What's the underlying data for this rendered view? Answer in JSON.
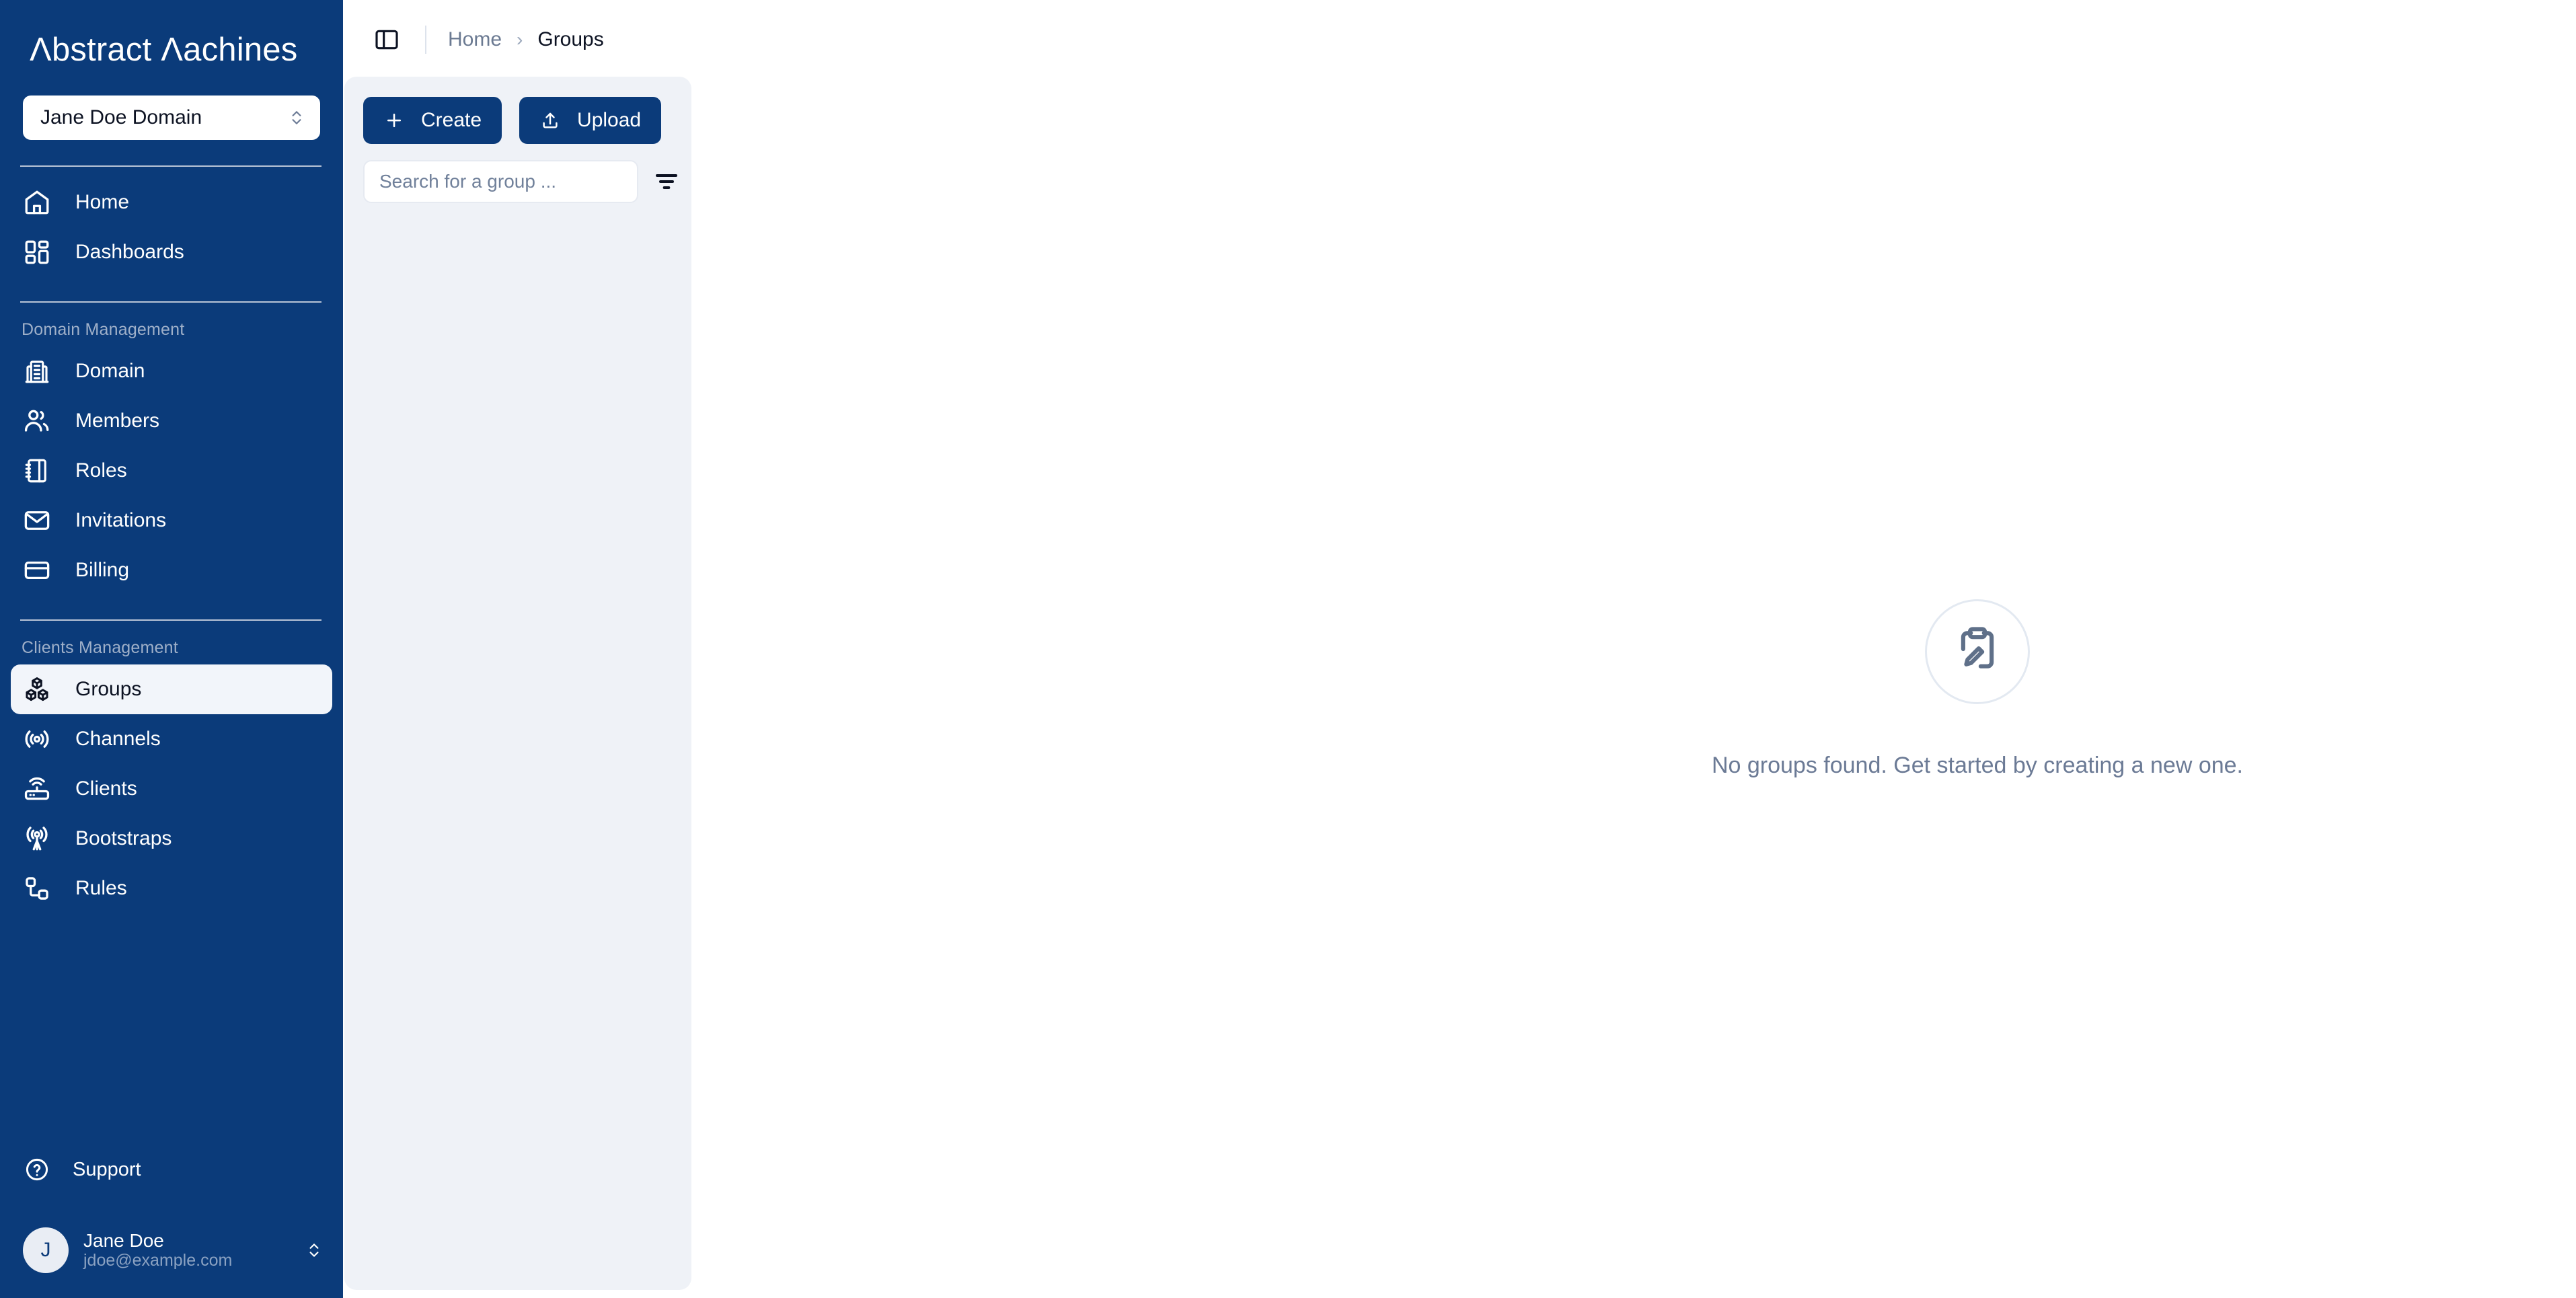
{
  "brand": {
    "name": "Abstract Machines",
    "name_prefix_a": "Λ",
    "name_rest": "bstract ",
    "name_m": "Λ",
    "name_tail": "achines"
  },
  "sidebar": {
    "domain_selector": {
      "value": "Jane Doe Domain",
      "icon": "chevron-up-down-icon"
    },
    "primary_items": [
      {
        "label": "Home",
        "icon": "home-icon",
        "active": false
      },
      {
        "label": "Dashboards",
        "icon": "dashboards-grid-icon",
        "active": false
      }
    ],
    "sections": [
      {
        "label": "Domain Management",
        "items": [
          {
            "label": "Domain",
            "icon": "building-icon",
            "active": false
          },
          {
            "label": "Members",
            "icon": "users-icon",
            "active": false
          },
          {
            "label": "Roles",
            "icon": "notebook-icon",
            "active": false
          },
          {
            "label": "Invitations",
            "icon": "envelope-icon",
            "active": false
          },
          {
            "label": "Billing",
            "icon": "credit-card-icon",
            "active": false
          }
        ]
      },
      {
        "label": "Clients Management",
        "items": [
          {
            "label": "Groups",
            "icon": "boxes-icon",
            "active": true
          },
          {
            "label": "Channels",
            "icon": "broadcast-icon",
            "active": false
          },
          {
            "label": "Clients",
            "icon": "router-icon",
            "active": false
          },
          {
            "label": "Bootstraps",
            "icon": "antenna-icon",
            "active": false
          },
          {
            "label": "Rules",
            "icon": "rules-nodes-icon",
            "active": false
          }
        ]
      }
    ],
    "support": {
      "label": "Support",
      "icon": "help-circle-icon"
    },
    "user": {
      "initial": "J",
      "name": "Jane Doe",
      "email": "jdoe@example.com",
      "icon": "chevron-up-down-icon"
    }
  },
  "topbar": {
    "sidebar_toggle_icon": "panel-toggle-icon",
    "breadcrumb": [
      {
        "label": "Home",
        "current": false
      },
      {
        "label": "Groups",
        "current": true
      }
    ],
    "breadcrumb_separator": "›"
  },
  "toolbar": {
    "create_label": "Create",
    "create_icon": "plus-icon",
    "upload_label": "Upload",
    "upload_icon": "upload-icon",
    "search_placeholder": "Search for a group ...",
    "search_value": "",
    "filter_icon": "filter-icon"
  },
  "empty_state": {
    "icon": "clipboard-pen-icon",
    "message": "No groups found. Get started by creating a new one."
  },
  "colors": {
    "sidebar_blue": "#0B3B7A",
    "panel_bg": "#eff2f7",
    "active_item_bg": "#f2f5fa",
    "muted_text": "#6b7a95",
    "section_label": "#9fb0c9"
  }
}
